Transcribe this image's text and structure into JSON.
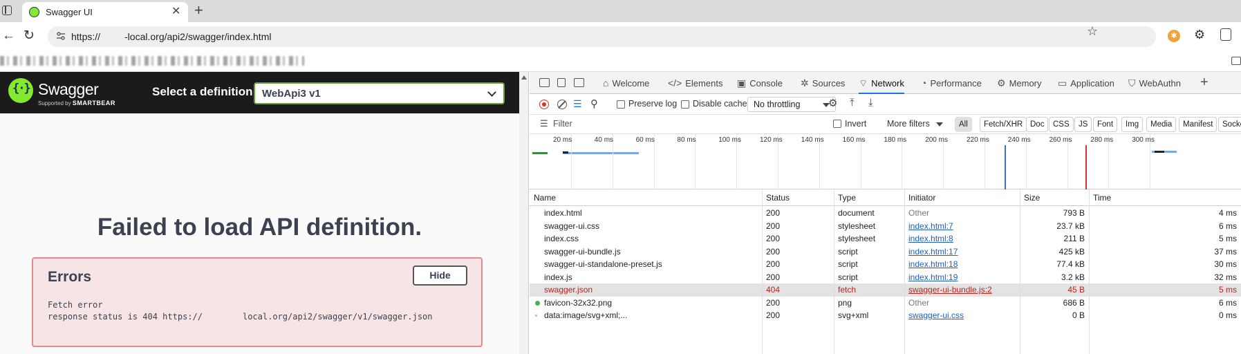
{
  "browser": {
    "tab_title": "Swagger UI",
    "url": "https://     -local.org/api2/swagger/index.html"
  },
  "swagger": {
    "brand": "Swagger",
    "brand_sub_prefix": "Supported by",
    "brand_sub_company": "SMARTBEAR",
    "select_label": "Select a definition",
    "selected_definition": "WebApi3 v1",
    "failed_message": "Failed to load API definition.",
    "errors_title": "Errors",
    "hide_label": "Hide",
    "error_line1": "Fetch error",
    "error_line2_prefix": "response status is 404 https://",
    "error_line2_suffix": "local.org/api2/swagger/v1/swagger.json"
  },
  "devtools": {
    "tabs": [
      {
        "label": "Welcome",
        "icon": "home-icon"
      },
      {
        "label": "Elements",
        "icon": "code-icon"
      },
      {
        "label": "Console",
        "icon": "console-icon"
      },
      {
        "label": "Sources",
        "icon": "bug-icon"
      },
      {
        "label": "Network",
        "icon": "wifi-icon"
      },
      {
        "label": "Performance",
        "icon": "performance-icon"
      },
      {
        "label": "Memory",
        "icon": "memory-icon"
      },
      {
        "label": "Application",
        "icon": "application-icon"
      },
      {
        "label": "WebAuthn",
        "icon": "shield-icon"
      }
    ],
    "active_tab": "Network",
    "toolbar": {
      "preserve_log": "Preserve log",
      "disable_cache": "Disable cache",
      "throttling": "No throttling"
    },
    "filter": {
      "placeholder": "Filter",
      "invert": "Invert",
      "more_filters": "More filters",
      "chips": [
        "All",
        "Fetch/XHR",
        "Doc",
        "CSS",
        "JS",
        "Font",
        "Img",
        "Media",
        "Manifest",
        "Socke"
      ]
    },
    "timeline_ticks": [
      "20 ms",
      "40 ms",
      "60 ms",
      "80 ms",
      "100 ms",
      "120 ms",
      "140 ms",
      "160 ms",
      "180 ms",
      "200 ms",
      "220 ms",
      "240 ms",
      "260 ms",
      "280 ms",
      "300 ms"
    ],
    "columns": [
      "Name",
      "Status",
      "Type",
      "Initiator",
      "Size",
      "Time"
    ],
    "rows": [
      {
        "name": "index.html",
        "status": "200",
        "type": "document",
        "initiator": "Other",
        "size": "793 B",
        "time": "4 ms"
      },
      {
        "name": "swagger-ui.css",
        "status": "200",
        "type": "stylesheet",
        "initiator": "index.html:7",
        "size": "23.7 kB",
        "time": "6 ms"
      },
      {
        "name": "index.css",
        "status": "200",
        "type": "stylesheet",
        "initiator": "index.html:8",
        "size": "211 B",
        "time": "5 ms"
      },
      {
        "name": "swagger-ui-bundle.js",
        "status": "200",
        "type": "script",
        "initiator": "index.html:17",
        "size": "425 kB",
        "time": "37 ms"
      },
      {
        "name": "swagger-ui-standalone-preset.js",
        "status": "200",
        "type": "script",
        "initiator": "index.html:18",
        "size": "77.4 kB",
        "time": "30 ms"
      },
      {
        "name": "index.js",
        "status": "200",
        "type": "script",
        "initiator": "index.html:19",
        "size": "3.2 kB",
        "time": "32 ms"
      },
      {
        "name": "swagger.json",
        "status": "404",
        "type": "fetch",
        "initiator": "swagger-ui-bundle.js:2",
        "size": "45 B",
        "time": "5 ms"
      },
      {
        "name": "favicon-32x32.png",
        "status": "200",
        "type": "png",
        "initiator": "Other",
        "size": "686 B",
        "time": "6 ms"
      },
      {
        "name": "data:image/svg+xml;...",
        "status": "200",
        "type": "svg+xml",
        "initiator": "swagger-ui.css",
        "size": "0 B",
        "time": "0 ms"
      }
    ],
    "colors": {
      "accent": "#1a73e8",
      "error": "#b3261e",
      "swagger_green": "#85ea2d"
    }
  }
}
